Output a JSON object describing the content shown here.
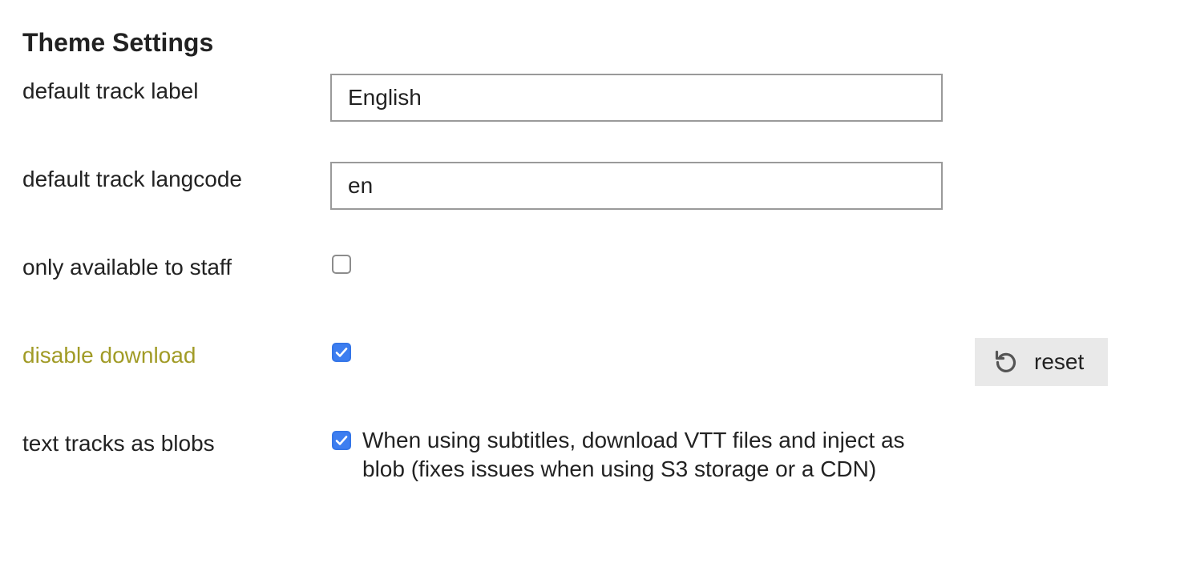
{
  "title": "Theme Settings",
  "colors": {
    "modified_label": "#a19b26",
    "checkbox_checked": "#3d7ef0",
    "reset_button_bg": "#e9e9e9"
  },
  "settings": {
    "default_track_label": {
      "label": "default track label",
      "value": "English"
    },
    "default_track_langcode": {
      "label": "default track langcode",
      "value": "en"
    },
    "only_available_to_staff": {
      "label": "only available to staff",
      "checked": false
    },
    "disable_download": {
      "label": "disable download",
      "checked": true,
      "modified": true,
      "reset_label": "reset",
      "reset_icon": "undo-icon"
    },
    "text_tracks_as_blobs": {
      "label": "text tracks as blobs",
      "checked": true,
      "description": "When using subtitles, download VTT files and inject as blob (fixes issues when using S3 storage or a CDN)"
    }
  }
}
